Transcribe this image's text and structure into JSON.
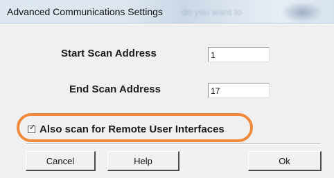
{
  "window": {
    "title": "Advanced Communications Settings",
    "title_obscured_text": "do you want to"
  },
  "form": {
    "start_scan_address": {
      "label": "Start Scan Address",
      "value": "1"
    },
    "end_scan_address": {
      "label": "End Scan Address",
      "value": "17"
    },
    "remote_ui_scan": {
      "label": "Also scan for Remote User Interfaces",
      "checked": true,
      "check_glyph": "✓"
    }
  },
  "buttons": {
    "cancel": "Cancel",
    "help": "Help",
    "ok": "Ok"
  },
  "colors": {
    "highlight": "#f08a3a",
    "window_bg": "#f0f0f0",
    "titlebar_bg": "#dfe8f2"
  },
  "icons": {
    "checkbox_mark": "check-icon"
  }
}
